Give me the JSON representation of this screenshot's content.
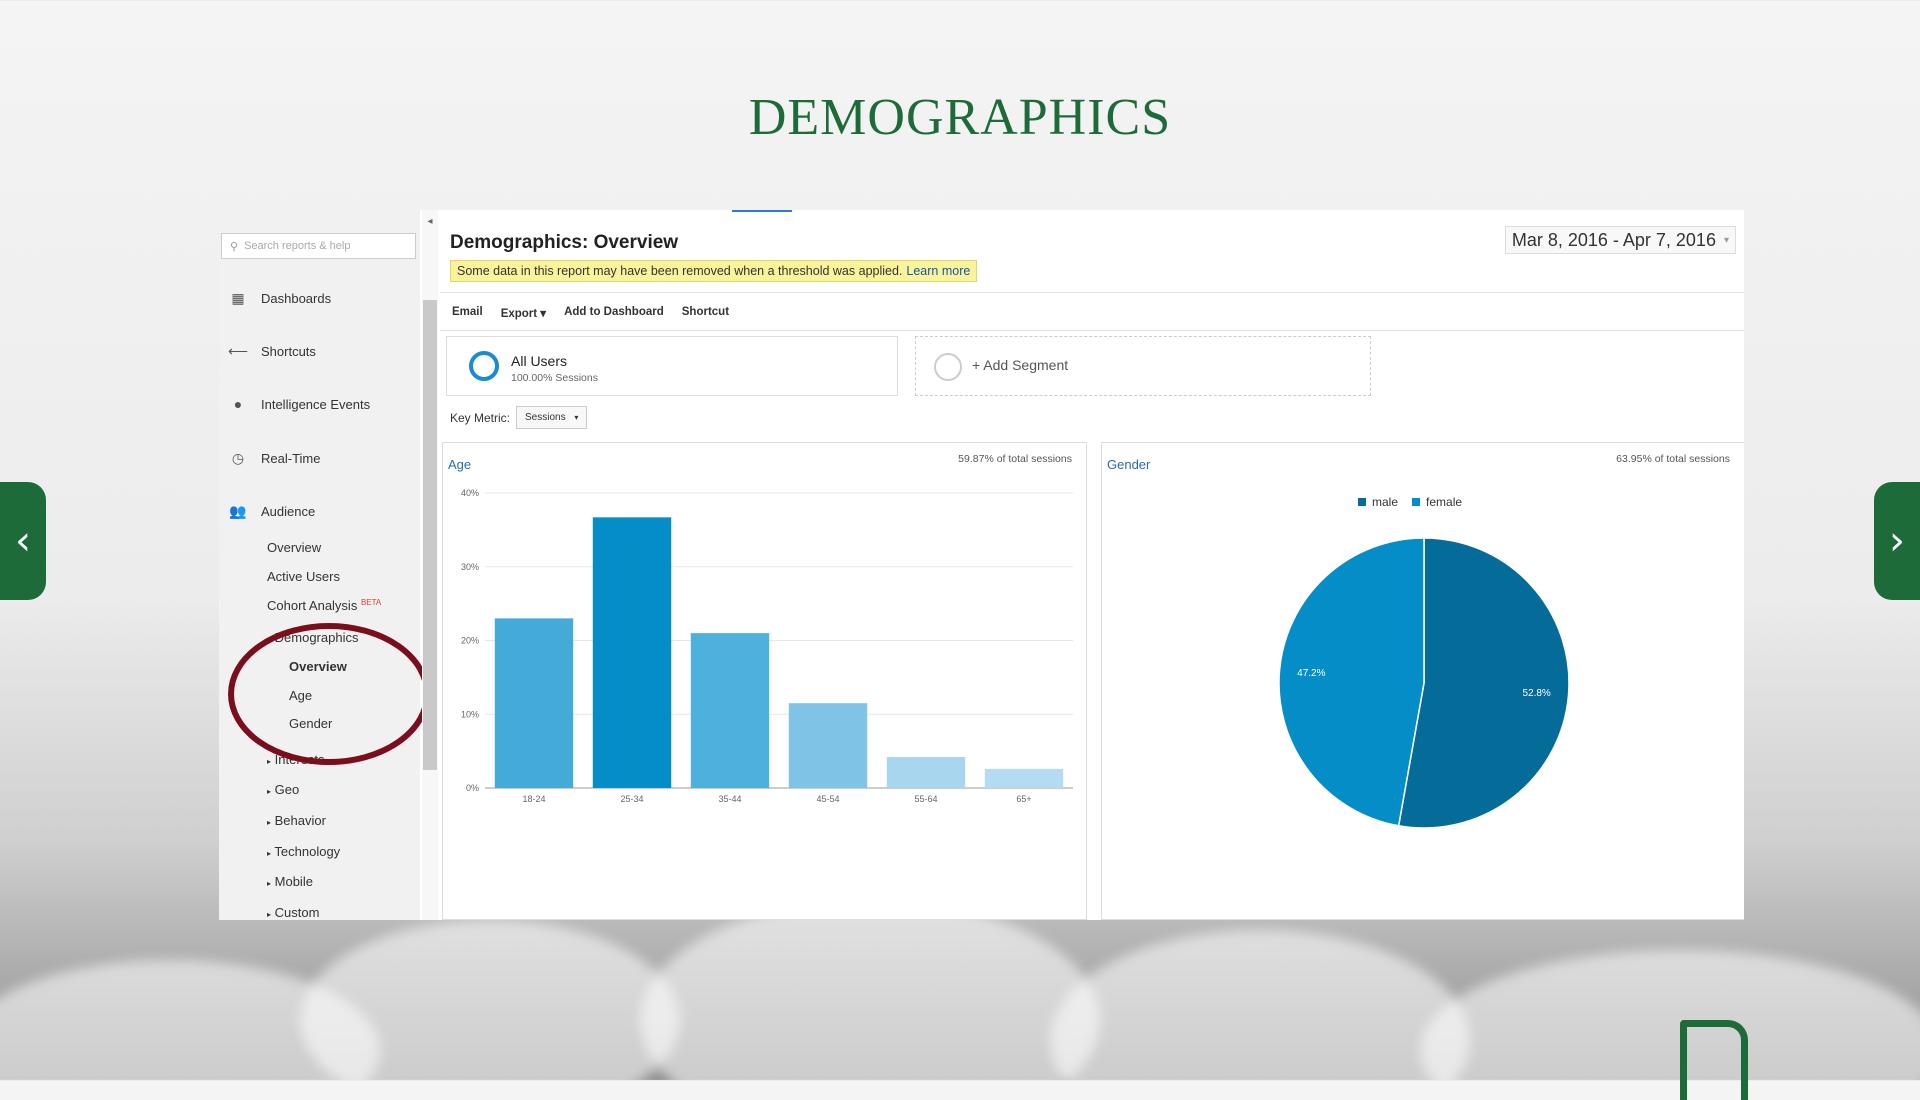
{
  "slide": {
    "title": "DEMOGRAPHICS",
    "prev_label": "‹",
    "next_label": "›",
    "accent": "#1e6b3a"
  },
  "sidebar": {
    "search_placeholder": "Search reports & help",
    "items": [
      {
        "label": "Dashboards",
        "icon": "grid-icon"
      },
      {
        "label": "Shortcuts",
        "icon": "shortcut-arrow-icon"
      },
      {
        "label": "Intelligence Events",
        "icon": "lightbulb-icon"
      },
      {
        "label": "Real-Time",
        "icon": "clock-icon"
      },
      {
        "label": "Audience",
        "icon": "people-icon"
      }
    ],
    "audience_sub": [
      "Overview",
      "Active Users",
      "Cohort Analysis"
    ],
    "beta": "BETA",
    "demographics": "Demographics",
    "demographics_sub": [
      "Overview",
      "Age",
      "Gender"
    ],
    "collapsed": [
      "Interests",
      "Geo",
      "Behavior",
      "Technology",
      "Mobile",
      "Custom"
    ]
  },
  "header": {
    "title": "Demographics: Overview",
    "date_range": "Mar 8, 2016 - Apr 7, 2016",
    "warning": "Some data in this report may have been removed when a threshold was applied.",
    "learn_more": "Learn more"
  },
  "toolbar": {
    "email": "Email",
    "export": "Export ▾",
    "add_dashboard": "Add to Dashboard",
    "shortcut": "Shortcut"
  },
  "segments": {
    "all_users": "All Users",
    "all_users_sub": "100.00% Sessions",
    "add_segment": "+ Add Segment"
  },
  "key_metric": {
    "label": "Key Metric:",
    "value": "Sessions"
  },
  "age_panel": {
    "title": "Age",
    "pct": "59.87% of total sessions"
  },
  "gender_panel": {
    "title": "Gender",
    "pct": "63.95% of total sessions"
  },
  "chart_data": [
    {
      "type": "bar",
      "categories": [
        "18-24",
        "25-34",
        "35-44",
        "45-54",
        "55-64",
        "65+"
      ],
      "values": [
        23,
        36.7,
        21,
        11.5,
        4.2,
        2.6
      ],
      "ylim": [
        0,
        40
      ],
      "yticks": [
        "0%",
        "10%",
        "20%",
        "30%",
        "40%"
      ],
      "colors": [
        "#44aad8",
        "#058dc7",
        "#4eb0dc",
        "#7fc4e6",
        "#a8d6ef",
        "#b3dcf2"
      ],
      "grid": true
    },
    {
      "type": "pie",
      "labels": [
        "male",
        "female"
      ],
      "values": [
        52.8,
        47.2
      ],
      "value_labels": [
        "52.8%",
        "47.2%"
      ],
      "colors": [
        "#056b99",
        "#058dc7"
      ],
      "legend": "top"
    }
  ]
}
